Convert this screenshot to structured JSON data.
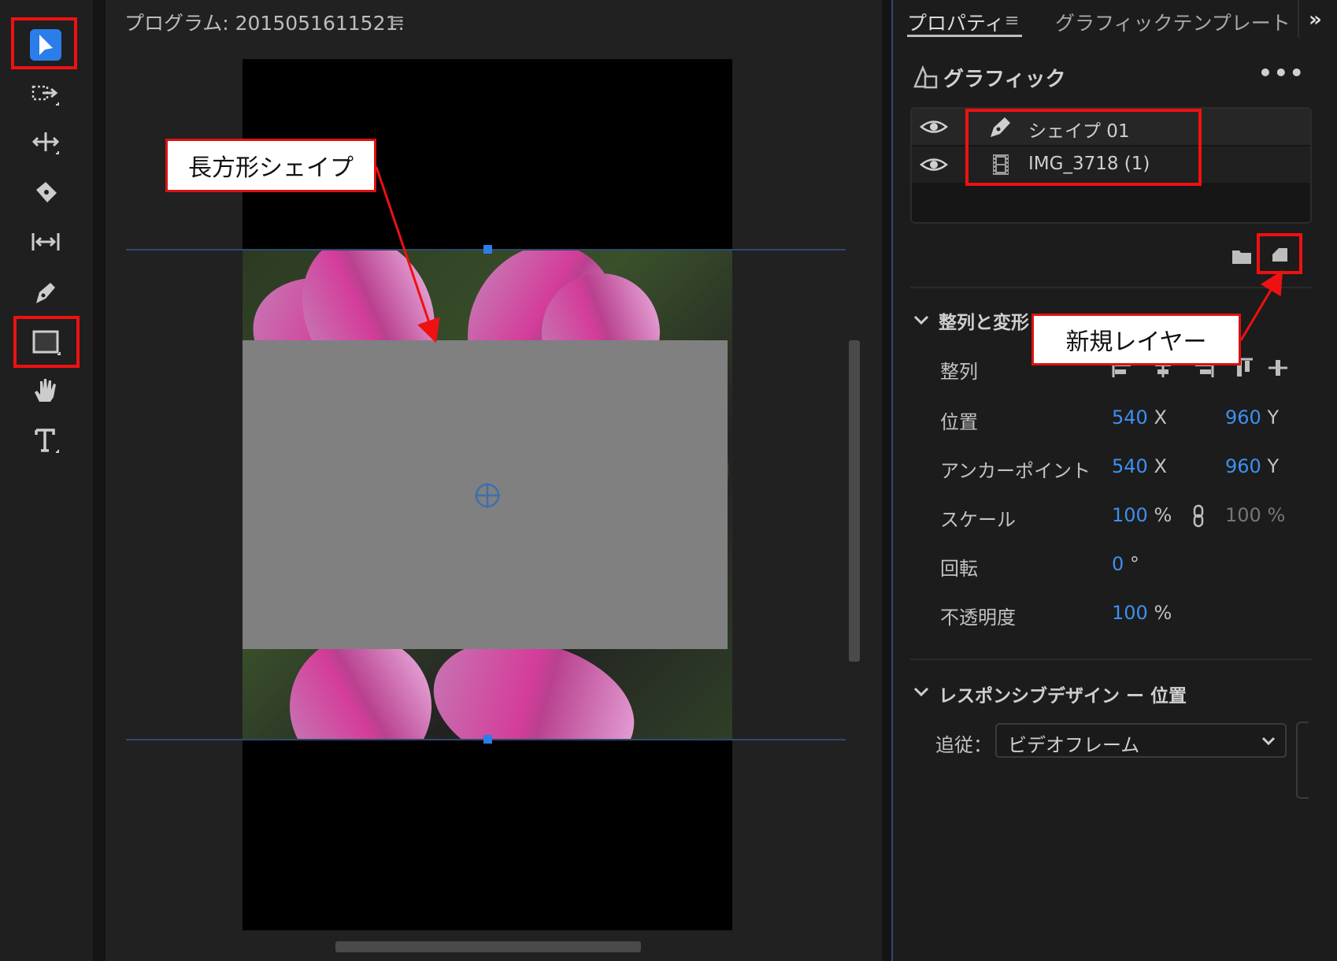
{
  "toolbar": {
    "tools": [
      {
        "name": "selection-tool",
        "icon": "arrow-cursor-icon",
        "active": true
      },
      {
        "name": "track-select-forward-tool",
        "icon": "track-select-icon"
      },
      {
        "name": "ripple-edit-tool",
        "icon": "ripple-edit-icon"
      },
      {
        "name": "razor-tool",
        "icon": "razor-icon"
      },
      {
        "name": "slip-tool",
        "icon": "slip-icon"
      },
      {
        "name": "pen-tool",
        "icon": "pen-icon"
      },
      {
        "name": "rectangle-tool",
        "icon": "rectangle-icon"
      },
      {
        "name": "hand-tool",
        "icon": "hand-icon"
      },
      {
        "name": "type-tool",
        "icon": "type-icon"
      }
    ],
    "active_color": "#2b7de9"
  },
  "monitor": {
    "title": "プログラム: 2015051611521:",
    "menu_icon": "hamburger-icon"
  },
  "panel": {
    "tabs": [
      {
        "label": "プロパティ",
        "active": true
      },
      {
        "label": "グラフィックテンプレート",
        "active": false
      }
    ],
    "more_icon": "double-chevron-right-icon",
    "graphic": {
      "title": "グラフィック",
      "menu": "•••",
      "layers": [
        {
          "name": "シェイプ 01",
          "icon": "pen-icon",
          "visible": true
        },
        {
          "name": "IMG_3718 (1)",
          "icon": "film-icon",
          "visible": true
        }
      ]
    },
    "align_transform": {
      "title": "整列と変形",
      "align_label": "整列",
      "position": {
        "label": "位置",
        "x": "540",
        "y": "960"
      },
      "anchor": {
        "label": "アンカーポイント",
        "x": "540",
        "y": "960"
      },
      "scale": {
        "label": "スケール",
        "value": "100",
        "linked_value": "100",
        "unit": "%"
      },
      "rotation": {
        "label": "回転",
        "value": "0",
        "unit": "°"
      },
      "opacity": {
        "label": "不透明度",
        "value": "100",
        "unit": "%"
      },
      "x_unit": "X",
      "y_unit": "Y",
      "value_color": "#3d8ff0"
    },
    "responsive": {
      "title": "レスポンシブデザイン ー 位置",
      "follow_label": "追従：",
      "follow_value": "ビデオフレーム"
    }
  },
  "annotations": {
    "rect_shape": "長方形シェイプ",
    "new_layer": "新規レイヤー",
    "highlight_color": "#e11111"
  }
}
